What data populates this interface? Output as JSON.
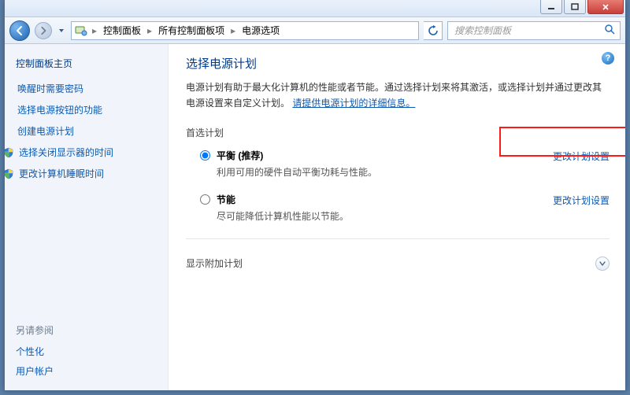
{
  "titlebar": {
    "min_tip": "minimize",
    "max_tip": "maximize",
    "close_tip": "close"
  },
  "nav": {
    "crumbs": [
      "控制面板",
      "所有控制面板项",
      "电源选项"
    ],
    "search_placeholder": "搜索控制面板"
  },
  "sidebar": {
    "home": "控制面板主页",
    "links": [
      "唤醒时需要密码",
      "选择电源按钮的功能",
      "创建电源计划",
      "选择关闭显示器的时间",
      "更改计算机睡眠时间"
    ],
    "see_also_title": "另请参阅",
    "see_also": [
      "个性化",
      "用户帐户"
    ]
  },
  "main": {
    "heading": "选择电源计划",
    "desc_prefix": "电源计划有助于最大化计算机的性能或者节能。通过选择计划来将其激活，或选择计划并通过更改其电源设置来自定义计划。",
    "desc_link": "请提供电源计划的详细信息。",
    "preferred_label": "首选计划",
    "plans": [
      {
        "title_bold": "平衡 (推荐)",
        "sub": "利用可用的硬件自动平衡功耗与性能。",
        "change_link": "更改计划设置",
        "checked": true
      },
      {
        "title_bold": "节能",
        "sub": "尽可能降低计算机性能以节能。",
        "change_link": "更改计划设置",
        "checked": false
      }
    ],
    "additional_label": "显示附加计划",
    "help_glyph": "?"
  }
}
